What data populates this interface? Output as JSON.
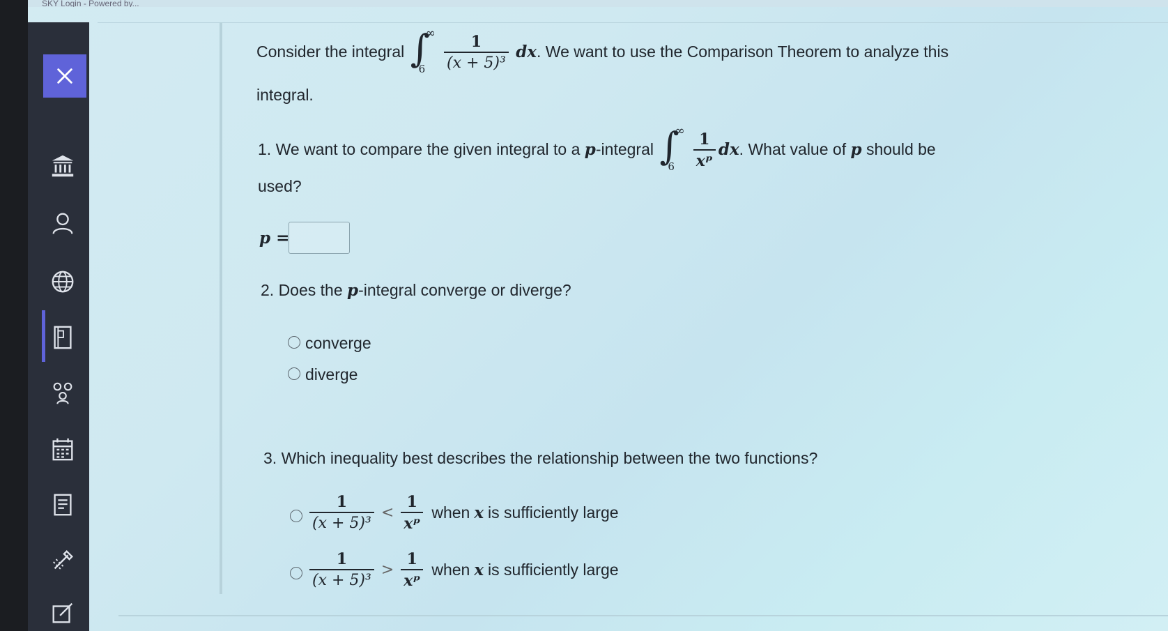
{
  "browser": {
    "tab_title": "SKY Login - Powered by..."
  },
  "sidebar": {
    "close_label": "Close",
    "items": [
      {
        "name": "institution-icon"
      },
      {
        "name": "profile-icon"
      },
      {
        "name": "globe-icon"
      },
      {
        "name": "courses-icon"
      },
      {
        "name": "groups-icon"
      },
      {
        "name": "calendar-icon"
      },
      {
        "name": "assignments-icon"
      },
      {
        "name": "tools-icon"
      },
      {
        "name": "edit-icon"
      }
    ]
  },
  "colors": {
    "accent": "#5f63d9",
    "sidebar_bg": "#2a2f3a"
  },
  "problem": {
    "intro_prefix": "Consider the integral",
    "intro_suffix": ". We want to use the Comparison Theorem to analyze this",
    "intro_line2": "integral.",
    "integral": {
      "lower": "6",
      "upper": "∞",
      "numerator": "1",
      "denominator": "(x + 5)³",
      "differential": "dx"
    }
  },
  "question1": {
    "prefix": "1. We want to compare the given integral to a ",
    "p_symbol": "p",
    "mid": "-integral",
    "suffix_a": ". What value of ",
    "suffix_b": " should be",
    "line2": "used?",
    "integral": {
      "lower": "6",
      "upper": "∞",
      "numerator": "1",
      "denominator": "xᵖ",
      "differential": "dx"
    },
    "answer_label": "p =",
    "answer_value": ""
  },
  "question2": {
    "prefix": "2. Does the ",
    "p_symbol": "p",
    "suffix": "-integral converge or diverge?",
    "options": [
      {
        "label": "converge",
        "selected": false
      },
      {
        "label": "diverge",
        "selected": false
      }
    ]
  },
  "question3": {
    "text": "3. Which inequality best describes the relationship between the two functions?",
    "options": [
      {
        "left_num": "1",
        "left_den": "(x + 5)³",
        "relation": "<",
        "right_num": "1",
        "right_den": "xᵖ",
        "when_prefix": "when ",
        "var": "x",
        "when_suffix": " is sufficiently large",
        "selected": false
      },
      {
        "left_num": "1",
        "left_den": "(x + 5)³",
        "relation": ">",
        "right_num": "1",
        "right_den": "xᵖ",
        "when_prefix": "when ",
        "var": "x",
        "when_suffix": " is sufficiently large",
        "selected": false
      }
    ]
  }
}
